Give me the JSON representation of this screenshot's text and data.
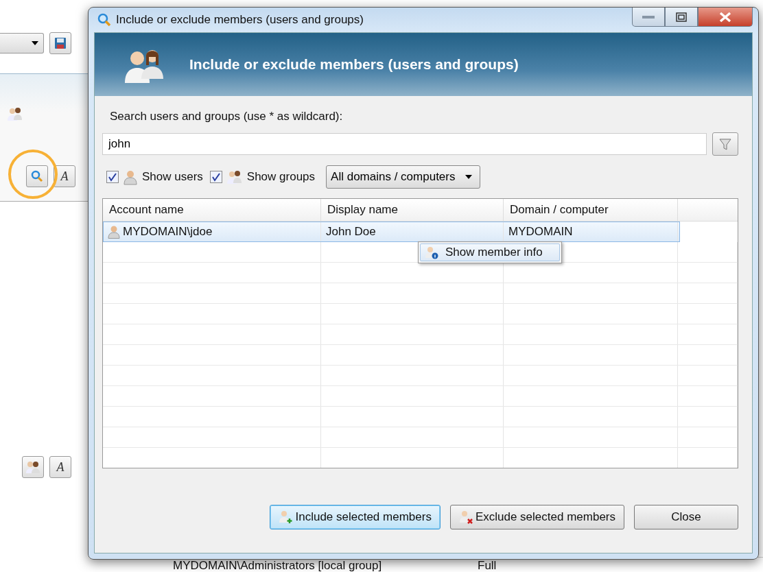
{
  "background": {
    "format_buttons": [
      "A",
      "A"
    ],
    "bottom_row": {
      "account": "MYDOMAIN\\Administrators [local group]",
      "access": "Full"
    }
  },
  "dialog": {
    "title": "Include or exclude members (users and groups)",
    "header_title": "Include or exclude members (users and groups)",
    "search": {
      "label": "Search users and groups (use * as wildcard):",
      "value": "john"
    },
    "filters": [
      {
        "kind": "user",
        "label": "Show users",
        "checked": true
      },
      {
        "kind": "group",
        "label": "Show groups",
        "checked": true
      }
    ],
    "domain_dropdown": {
      "value": "All domains / computers"
    },
    "table": {
      "columns": [
        "Account name",
        "Display name",
        "Domain / computer"
      ],
      "rows": [
        {
          "account": "MYDOMAIN\\jdoe",
          "display": "John Doe",
          "domain": "MYDOMAIN",
          "selected": true
        }
      ]
    },
    "context_menu": {
      "items": [
        "Show member info"
      ]
    },
    "buttons": [
      {
        "kind": "include",
        "label": "Include selected members",
        "selected": true
      },
      {
        "kind": "exclude",
        "label": "Exclude selected members",
        "selected": false
      },
      {
        "kind": "close",
        "label": "Close",
        "selected": false
      }
    ]
  }
}
